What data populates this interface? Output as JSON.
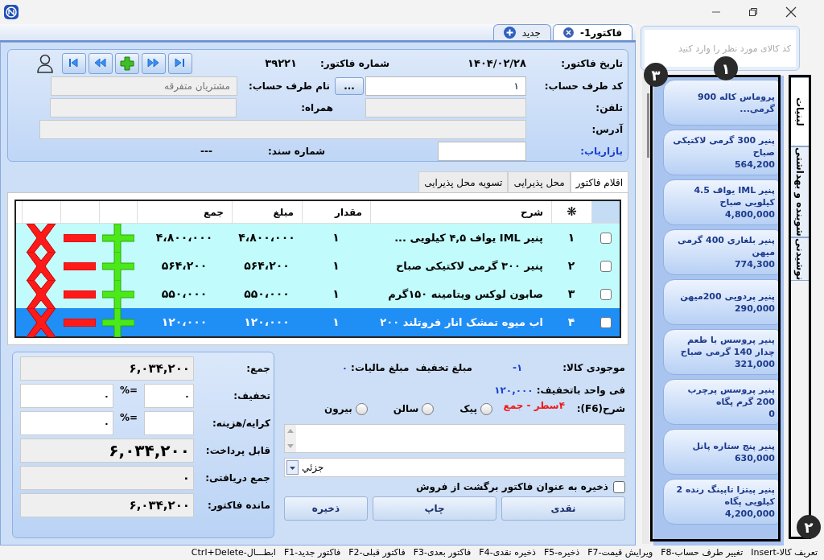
{
  "doc_tabs": [
    {
      "label": "فاکتور1-",
      "kind": "close",
      "selected": true
    },
    {
      "label": "جدید",
      "kind": "add",
      "selected": false
    }
  ],
  "header": {
    "date_label": "تاریخ فاکتور:",
    "date": "۱۴۰۴/۰۲/۲۸",
    "number_label": "شماره فاکتور:",
    "number": "۳۹۲۲۱",
    "code_label": "کد طرف حساب:",
    "code": "۱",
    "browse": "...",
    "name_label": "نام طرف حساب:",
    "name": "مشتریان متفرقه",
    "phone_label": "تلفن:",
    "mobile_label": "همراه:",
    "address_label": "آدرس:",
    "marketer_label": "بازاریاب:",
    "doc_no_label": "شماره سند:",
    "doc_no": "---"
  },
  "item_tabs": [
    {
      "label": "اقلام فاکتور",
      "selected": true
    },
    {
      "label": "محل پذیرایی",
      "selected": false
    },
    {
      "label": "تسویه محل پذیرایی",
      "selected": false
    }
  ],
  "table": {
    "columns": [
      "❋",
      "شرح",
      "مقدار",
      "مبلغ",
      "جمع"
    ],
    "rows": [
      {
        "checked": false,
        "selected": false,
        "cells": [
          "۱",
          "پنیر IML یواف ۴,۵ کیلویی ...",
          "۱",
          "۴،۸۰۰،۰۰۰",
          "۴،۸۰۰،۰۰۰"
        ]
      },
      {
        "checked": false,
        "selected": false,
        "cells": [
          "۲",
          "پنیر ۳۰۰ گرمی لاکتیکی صباح",
          "۱",
          "۵۶۴،۲۰۰",
          "۵۶۴،۲۰۰"
        ]
      },
      {
        "checked": false,
        "selected": false,
        "cells": [
          "۳",
          "صابون لوکس ویتامینه ۱۵۰گرم",
          "۱",
          "۵۵۰،۰۰۰",
          "۵۵۰،۰۰۰"
        ]
      },
      {
        "checked": false,
        "selected": true,
        "cells": [
          "۴",
          "اب میوه تمشک انار فروتلند ۲۰۰",
          "۱",
          "۱۲۰،۰۰۰",
          "۱۲۰،۰۰۰"
        ]
      }
    ]
  },
  "info": {
    "stock_label": "موجودی کالا:",
    "stock": "-۱",
    "discount_amount_label": "مبلغ تخفیف",
    "tax_label": "مبلغ مالیات:",
    "tax": "۰",
    "unit_label": "فی واحد باتخفیف:",
    "unit": "۱۲۰,۰۰۰",
    "desc_label": "شرح(F6):",
    "rows_note": "۴سطر - جمع"
  },
  "delivery": [
    {
      "label": "پیک",
      "selected": false
    },
    {
      "label": "سالن",
      "selected": false
    },
    {
      "label": "بیرون",
      "selected": false
    }
  ],
  "price_type": "جزئي",
  "return_option": {
    "label": "ذخیره به عنوان فاکتور برگشت از فروش",
    "checked": false
  },
  "actions": [
    "نقدی",
    "چاپ",
    "ذخیره"
  ],
  "totals": [
    {
      "kind": "plain",
      "label": "جمع:",
      "value": "۶,۰۳۴,۲۰۰"
    },
    {
      "kind": "percent",
      "label": "تخفیف:",
      "percent": "۰",
      "sign": "=%",
      "value": "۰"
    },
    {
      "kind": "percent",
      "label": "کرایه/هزینه:",
      "sign": "=%",
      "value": "۰"
    },
    {
      "kind": "large",
      "label": "قابل پرداخت:",
      "value": "۶,۰۳۴,۲۰۰"
    },
    {
      "kind": "plain",
      "label": "جمع دریافتی:",
      "value": "۰"
    },
    {
      "kind": "plain",
      "label": "مانده فاکتور:",
      "value": "۶,۰۳۴,۲۰۰"
    }
  ],
  "sidebar": {
    "search_placeholder": "کد کالای مورد نظر را وارد کنید",
    "products": [
      {
        "name": "پروماس کاله 900 گرمی..."
      },
      {
        "name": "پنیر 300 گرمی لاکتیکی صباح",
        "price": "564,200"
      },
      {
        "name": "پنیر IML یواف 4.5 کیلویی صباح",
        "price": "4,800,000"
      },
      {
        "name": "پنیر بلغاری 400 گرمی میهن",
        "price": "774,300"
      },
      {
        "name": "پنیر پردویی 200میهن",
        "price": "290,000"
      },
      {
        "name": "پنیر پروسس با طعم چدار 140 گرمی صباح",
        "price": "321,000"
      },
      {
        "name": "پنیر پروسس پرچرب 200 گرم پگاه",
        "price": "0"
      },
      {
        "name": "پنیر پنج ستاره پانل",
        "price": "630,000"
      },
      {
        "name": "پنیر پیتزا تاپینگ رنده 2 کیلویی پگاه",
        "price": "4,200,000"
      }
    ],
    "categories": [
      {
        "label": "لبنیات",
        "selected": true
      },
      {
        "label": "شوینده و بهداشتی",
        "selected": false
      },
      {
        "label": "نوشیدنی",
        "selected": false
      }
    ]
  },
  "annotations": [
    {
      "label": "۱"
    },
    {
      "label": "۲"
    },
    {
      "label": "۳"
    }
  ],
  "status_bar": [
    "Insert-تعریف کالا",
    "F8-تغییر طرف حساب",
    "F7-ویرایش قیمت",
    "F5-ذخیره",
    "F4-ذخیره نقدی",
    "F3-فاکتور بعدی",
    "F2-فاکتور قبلی",
    "F1-فاکتور جدید",
    "Ctrl+Delete-ابطـــال"
  ]
}
